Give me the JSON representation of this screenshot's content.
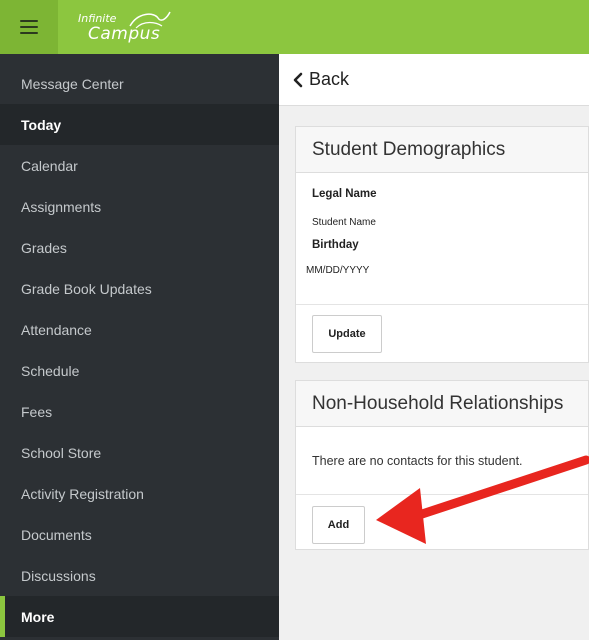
{
  "brand": {
    "name_top": "Infinite",
    "name_bottom": "Campus",
    "accent_color": "#8cc63f"
  },
  "sidebar": {
    "items": [
      {
        "label": "Message Center",
        "state": "normal"
      },
      {
        "label": "Today",
        "state": "active"
      },
      {
        "label": "Calendar",
        "state": "normal"
      },
      {
        "label": "Assignments",
        "state": "normal"
      },
      {
        "label": "Grades",
        "state": "normal"
      },
      {
        "label": "Grade Book Updates",
        "state": "normal"
      },
      {
        "label": "Attendance",
        "state": "normal"
      },
      {
        "label": "Schedule",
        "state": "normal"
      },
      {
        "label": "Fees",
        "state": "normal"
      },
      {
        "label": "School Store",
        "state": "normal"
      },
      {
        "label": "Activity Registration",
        "state": "normal"
      },
      {
        "label": "Documents",
        "state": "normal"
      },
      {
        "label": "Discussions",
        "state": "normal"
      },
      {
        "label": "More",
        "state": "more"
      }
    ]
  },
  "main": {
    "back_label": "Back",
    "demographics": {
      "title": "Student Demographics",
      "legal_name_label": "Legal Name",
      "legal_name_value": "Student Name",
      "birthday_label": "Birthday",
      "birthday_value": "MM/DD/YYYY",
      "update_label": "Update"
    },
    "non_household": {
      "title": "Non-Household Relationships",
      "empty_message": "There are no contacts for this student.",
      "add_label": "Add"
    }
  },
  "annotation": {
    "arrow_color": "#e8261f"
  }
}
